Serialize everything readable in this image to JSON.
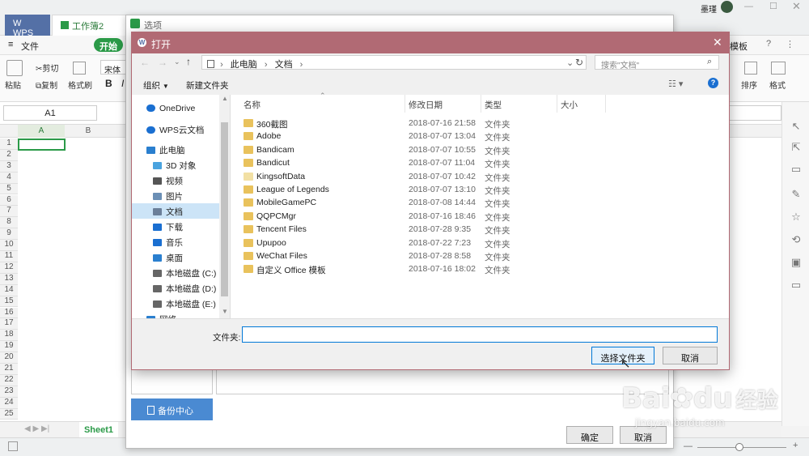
{
  "wps": {
    "tabs": [
      "WPS",
      "工作簿2"
    ],
    "user": "墨瑾",
    "menu": {
      "file": "文件",
      "start": "开始"
    },
    "ribbon": {
      "paste": "粘贴",
      "cut": "剪切",
      "copy": "复制",
      "format_painter": "格式刷",
      "font": "宋体",
      "bold": "B",
      "italic": "I",
      "sort": "排序",
      "format": "格式",
      "template": "模板"
    },
    "cell_ref": "A1",
    "columns": [
      "A",
      "B"
    ],
    "rows": [
      "1",
      "2",
      "3",
      "4",
      "5",
      "6",
      "7",
      "8",
      "9",
      "10",
      "11",
      "12",
      "13",
      "14",
      "15",
      "16",
      "17",
      "18",
      "19",
      "20",
      "21",
      "22",
      "23",
      "24",
      "25"
    ],
    "sheet_tab": "Sheet1"
  },
  "options_dialog": {
    "title": "选项",
    "backup_center": "备份中心",
    "ok": "确定",
    "cancel": "取消"
  },
  "open_dialog": {
    "title": "打开",
    "breadcrumb": [
      "此电脑",
      "文档"
    ],
    "search_placeholder": "搜索\"文档\"",
    "organize": "组织",
    "new_folder": "新建文件夹",
    "nav_items": [
      {
        "label": "OneDrive",
        "icon": "cloud-icon"
      },
      {
        "label": "WPS云文档",
        "icon": "cloud-icon"
      },
      {
        "label": "此电脑",
        "icon": "computer-icon"
      },
      {
        "label": "3D 对象",
        "icon": "cube-icon"
      },
      {
        "label": "视频",
        "icon": "video-icon"
      },
      {
        "label": "图片",
        "icon": "picture-icon"
      },
      {
        "label": "文档",
        "icon": "document-icon"
      },
      {
        "label": "下载",
        "icon": "download-icon"
      },
      {
        "label": "音乐",
        "icon": "music-icon"
      },
      {
        "label": "桌面",
        "icon": "desktop-icon"
      },
      {
        "label": "本地磁盘 (C:)",
        "icon": "drive-icon"
      },
      {
        "label": "本地磁盘 (D:)",
        "icon": "drive-icon"
      },
      {
        "label": "本地磁盘 (E:)",
        "icon": "drive-icon"
      },
      {
        "label": "网络",
        "icon": "network-icon"
      }
    ],
    "columns": [
      "名称",
      "修改日期",
      "类型",
      "大小"
    ],
    "files": [
      {
        "name": "360截图",
        "date": "2018-07-16 21:58",
        "type": "文件夹"
      },
      {
        "name": "Adobe",
        "date": "2018-07-07 13:04",
        "type": "文件夹"
      },
      {
        "name": "Bandicam",
        "date": "2018-07-07 10:55",
        "type": "文件夹"
      },
      {
        "name": "Bandicut",
        "date": "2018-07-07 11:04",
        "type": "文件夹"
      },
      {
        "name": "KingsoftData",
        "date": "2018-07-07 10:42",
        "type": "文件夹"
      },
      {
        "name": "League of Legends",
        "date": "2018-07-07 13:10",
        "type": "文件夹"
      },
      {
        "name": "MobileGamePC",
        "date": "2018-07-08 14:44",
        "type": "文件夹"
      },
      {
        "name": "QQPCMgr",
        "date": "2018-07-16 18:46",
        "type": "文件夹"
      },
      {
        "name": "Tencent Files",
        "date": "2018-07-28 9:35",
        "type": "文件夹"
      },
      {
        "name": "Upupoo",
        "date": "2018-07-22 7:23",
        "type": "文件夹"
      },
      {
        "name": "WeChat Files",
        "date": "2018-07-28 8:58",
        "type": "文件夹"
      },
      {
        "name": "自定义 Office 模板",
        "date": "2018-07-16 18:02",
        "type": "文件夹"
      }
    ],
    "folder_label": "文件夹:",
    "folder_value": "",
    "select_folder": "选择文件夹",
    "cancel": "取消"
  },
  "watermark": {
    "brand": "Bai",
    "brand2": "du",
    "brand_cn": "经验",
    "url": "jingyan.baidu.com"
  }
}
